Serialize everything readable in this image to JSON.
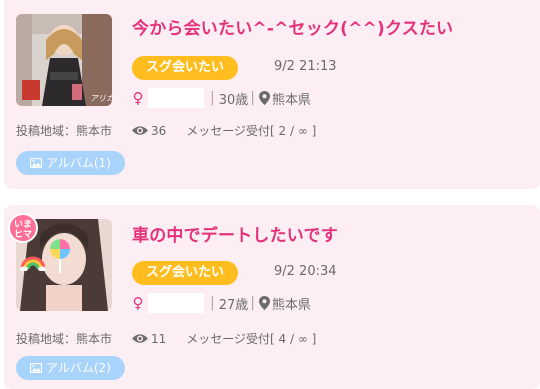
{
  "posts": [
    {
      "title": "今から会いたい^-^セック(^^)クスたい",
      "tag": "スグ会いたい",
      "date": "9/2 21:13",
      "gender_symbol": "♀",
      "age": "30歳",
      "separator": "|",
      "location": "熊本県",
      "area": "投稿地域：熊本市",
      "views": "36",
      "messages": "メッセージ受付[ 2 / ∞ ]",
      "album": "アルバム(1)",
      "avatar_watermark": "アリカ"
    },
    {
      "title": "車の中でデートしたいです",
      "tag": "スグ会いたい",
      "date": "9/2 20:34",
      "gender_symbol": "♀",
      "age": "27歳",
      "separator": "|",
      "location": "熊本県",
      "area": "投稿地域：熊本市",
      "views": "11",
      "messages": "メッセージ受付[ 4 / ∞ ]",
      "album": "アルバム(2)",
      "badge_line1": "いま",
      "badge_line2": "ヒマ"
    }
  ],
  "colors": {
    "card_bg": "#fdeef4",
    "title": "#e4327a",
    "tag_bg": "#ffbd1f",
    "album_bg": "#a8d3fb",
    "muted_text": "#6b6b6b"
  },
  "icons": {
    "gender": "female-symbol-icon",
    "location": "map-pin-icon",
    "views": "eye-icon",
    "album": "image-icon",
    "decoration": "rainbow-icon"
  }
}
